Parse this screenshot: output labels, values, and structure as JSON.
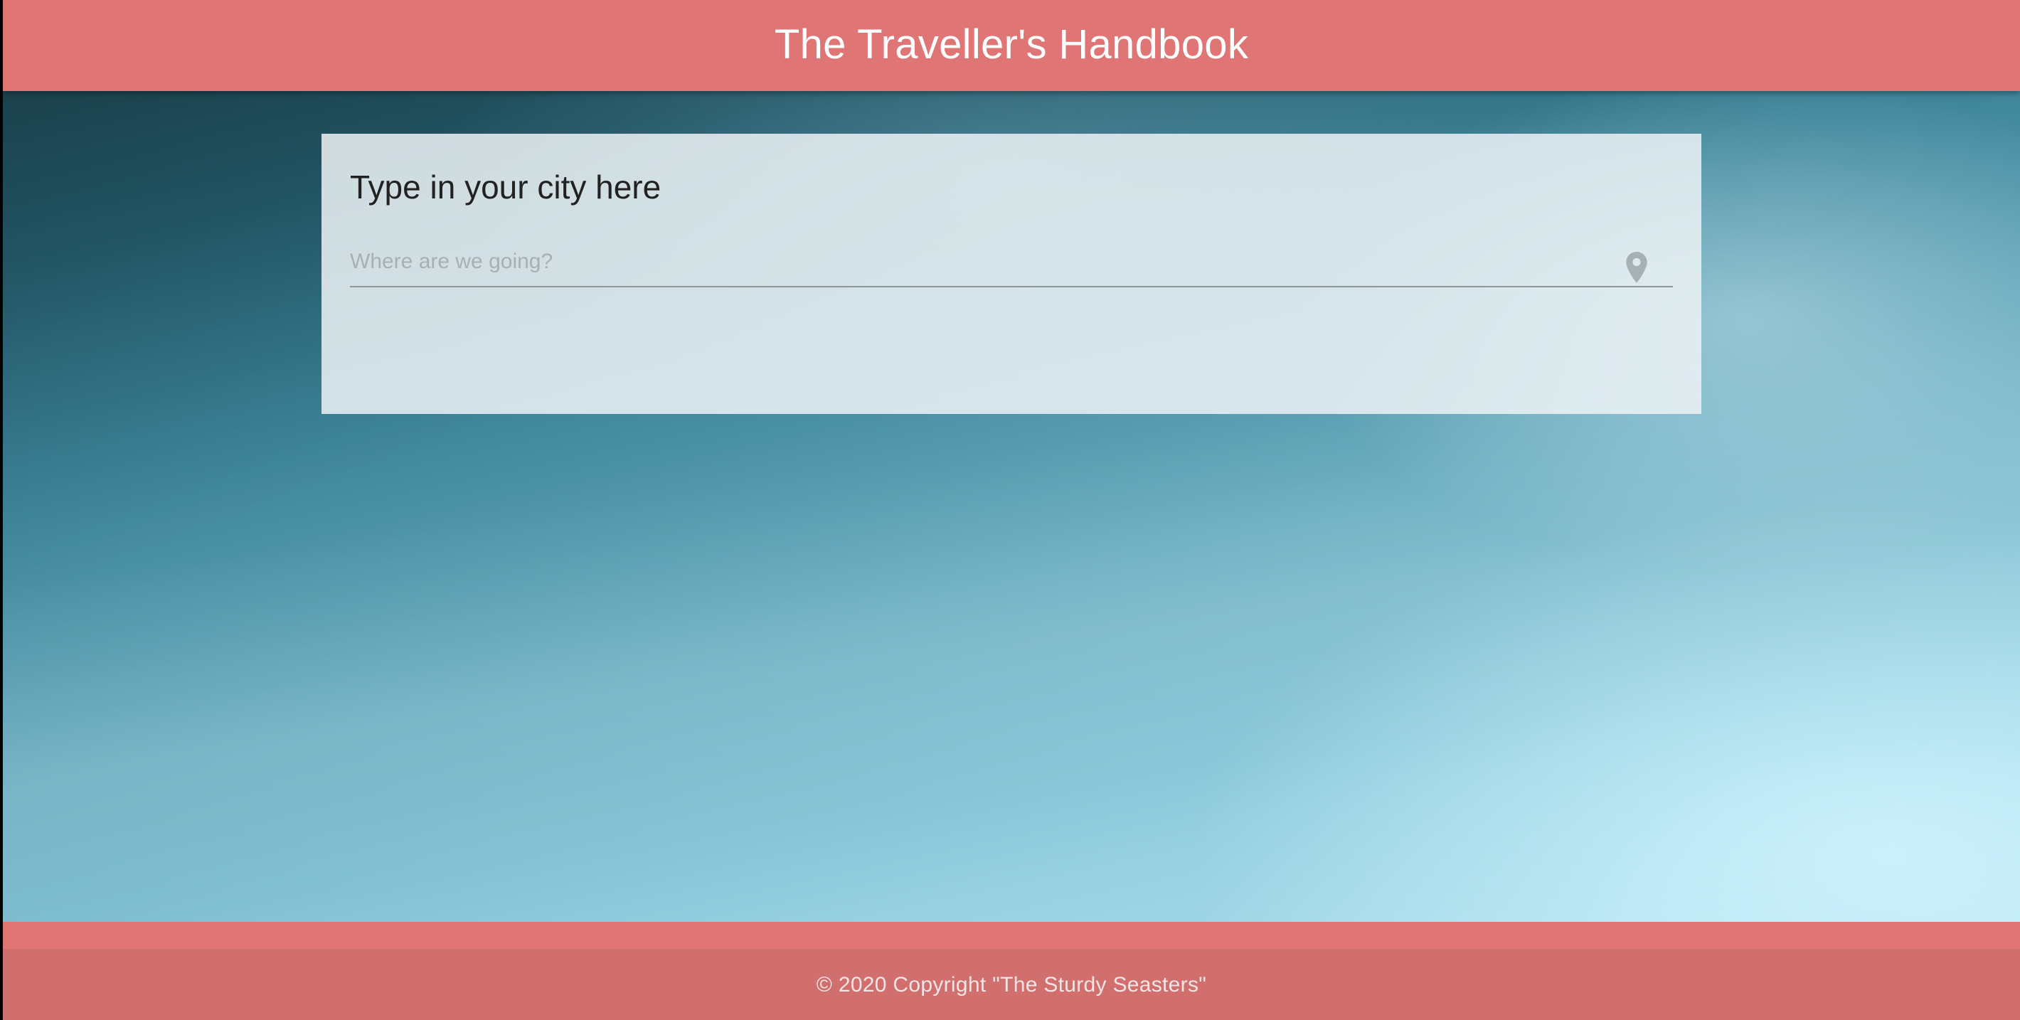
{
  "header": {
    "title": "The Traveller's Handbook"
  },
  "search": {
    "heading": "Type in your city here",
    "placeholder": "Where are we going?",
    "value": "",
    "icon": "location-pin-icon"
  },
  "footer": {
    "copyright": "© 2020 Copyright \"The Sturdy Seasters\""
  },
  "colors": {
    "header_bg": "#df7574",
    "footer_bg": "#d06f6e",
    "card_bg": "#eef3f5",
    "icon_color": "#a7b0b3"
  }
}
